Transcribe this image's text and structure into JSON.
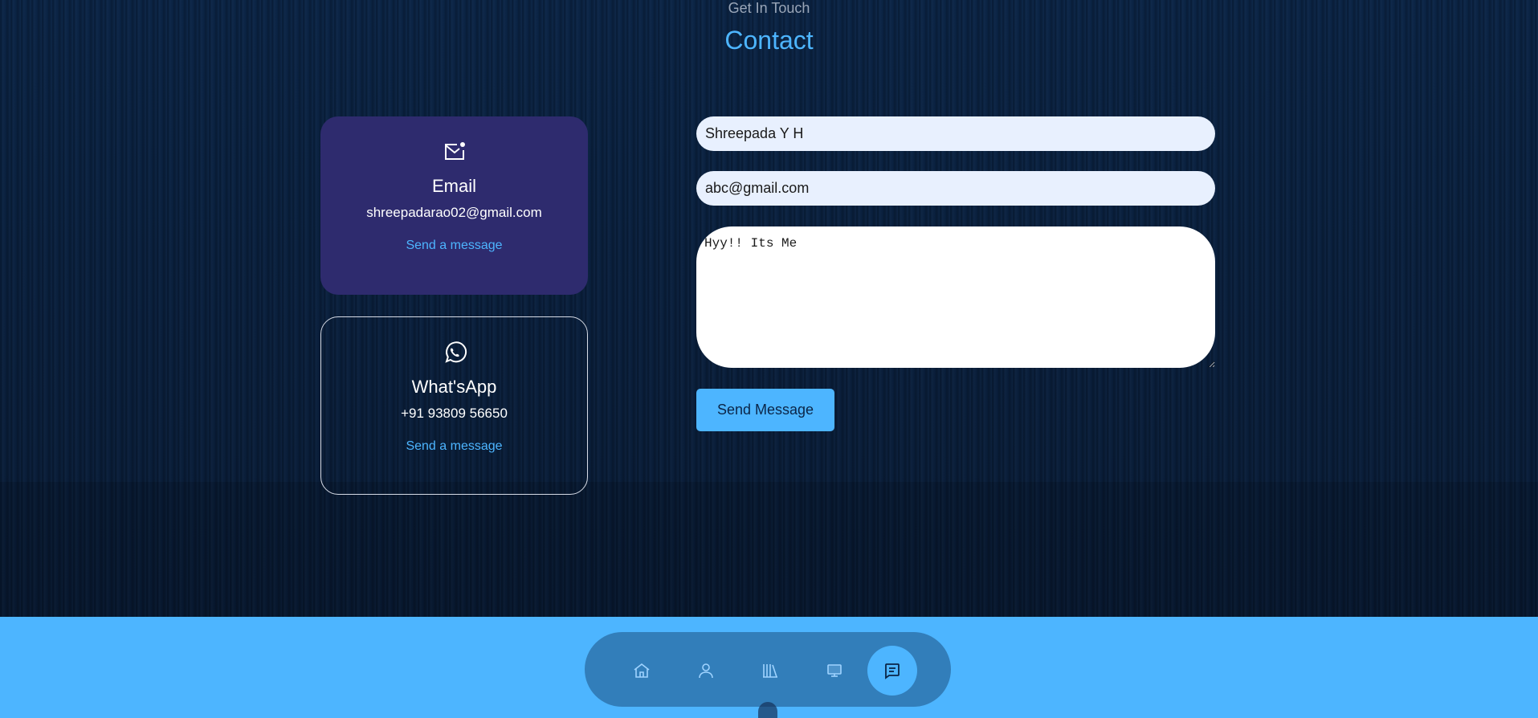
{
  "header": {
    "subtitle": "Get In Touch",
    "title": "Contact"
  },
  "contact_cards": [
    {
      "icon": "mail-icon",
      "title": "Email",
      "value": "shreepadarao02@gmail.com",
      "link_label": "Send a message"
    },
    {
      "icon": "whatsapp-icon",
      "title": "What'sApp",
      "value": "+91 93809 56650",
      "link_label": "Send a message"
    }
  ],
  "form": {
    "name_value": "Shreepada Y H",
    "email_value": "abc@gmail.com",
    "message_value": "Hyy!! Its Me",
    "submit_label": "Send Message"
  },
  "nav": {
    "items": [
      {
        "icon": "home-icon",
        "active": false
      },
      {
        "icon": "user-icon",
        "active": false
      },
      {
        "icon": "library-icon",
        "active": false
      },
      {
        "icon": "monitor-icon",
        "active": false
      },
      {
        "icon": "message-icon",
        "active": true
      }
    ]
  },
  "colors": {
    "accent": "#4db5ff",
    "email_card_bg": "#2e2b6e",
    "background": "#0a2140"
  }
}
